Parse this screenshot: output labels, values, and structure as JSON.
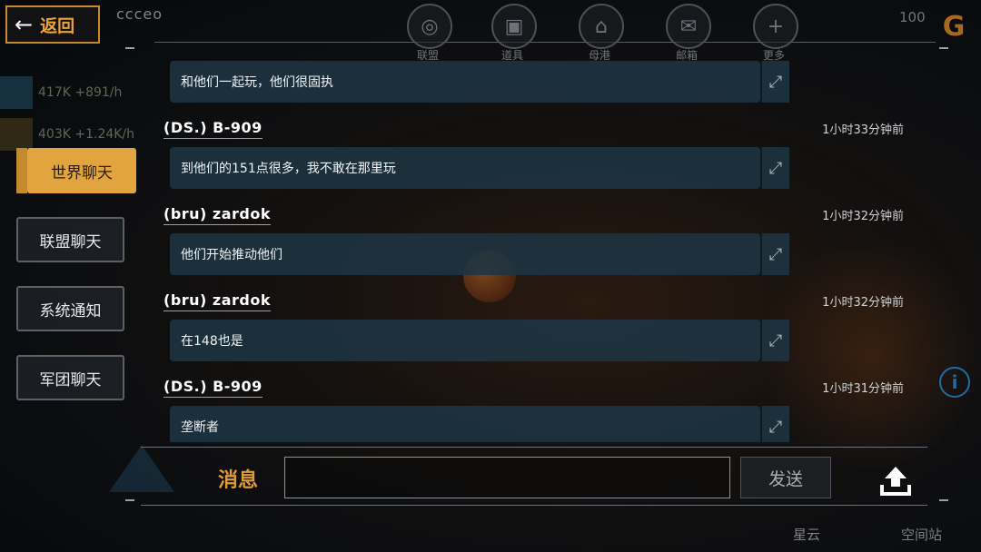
{
  "header": {
    "back_label": "返回",
    "player_name": "ccceo",
    "nav": [
      {
        "label": "联盟",
        "icon": "alliance-globe-icon"
      },
      {
        "label": "道具",
        "icon": "item-chest-icon"
      },
      {
        "label": "母港",
        "icon": "home-port-icon"
      },
      {
        "label": "邮箱",
        "icon": "mail-icon"
      },
      {
        "label": "更多",
        "icon": "more-plus-icon"
      }
    ],
    "count": "100"
  },
  "resources": [
    {
      "amount": "417K +891/h",
      "icon": "crystal-icon"
    },
    {
      "amount": "403K +1.24K/h",
      "icon": "gas-icon"
    }
  ],
  "tabs": [
    {
      "label": "世界聊天",
      "active": true
    },
    {
      "label": "联盟聊天",
      "active": false
    },
    {
      "label": "系统通知",
      "active": false
    },
    {
      "label": "军团聊天",
      "active": false
    }
  ],
  "messages": [
    {
      "sender": "",
      "time": "",
      "text": "和他们一起玩，他们很固执"
    },
    {
      "sender": "(DS.) B-909",
      "time": "1小时33分钟前",
      "text": "到他们的151点很多，我不敢在那里玩"
    },
    {
      "sender": "(bru) zardok",
      "time": "1小时32分钟前",
      "text": "他们开始推动他们"
    },
    {
      "sender": "(bru) zardok",
      "time": "1小时32分钟前",
      "text": "在148也是"
    },
    {
      "sender": "(DS.) B-909",
      "time": "1小时31分钟前",
      "text": "垄断者"
    }
  ],
  "composer": {
    "label": "消息",
    "value": "",
    "placeholder": "",
    "send_label": "发送"
  },
  "bottom_nav": {
    "nebula": "星云",
    "station": "空间站"
  },
  "colors": {
    "accent": "#e2a43e",
    "bubble": "#1e3442",
    "info": "#1d6ea6"
  }
}
